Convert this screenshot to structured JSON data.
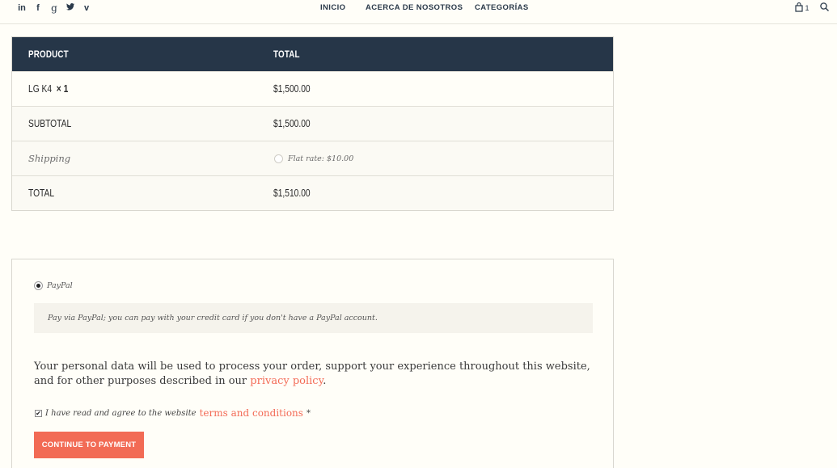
{
  "header": {
    "social": [
      "in",
      "f",
      "g",
      "t",
      "v"
    ],
    "social_icons": [
      "linkedin-icon",
      "facebook-icon",
      "google-plus-icon",
      "twitter-icon",
      "vimeo-icon"
    ],
    "nav": [
      "INICIO",
      "ACERCA DE NOSOTROS",
      "CATEGORÍAS"
    ],
    "cart_count": "1"
  },
  "order": {
    "head": {
      "product": "PRODUCT",
      "total": "TOTAL"
    },
    "item": {
      "name": "LG K4",
      "qty": "× 1",
      "total": "$1,500.00"
    },
    "subtotal": {
      "label": "SUBTOTAL",
      "value": "$1,500.00"
    },
    "shipping": {
      "label": "Shipping",
      "option": "Flat rate: $10.00"
    },
    "total": {
      "label": "TOTAL",
      "value": "$1,510.00"
    }
  },
  "payment": {
    "method": "PayPal",
    "description": "Pay via PayPal; you can pay with your credit card if you don't have a PayPal account.",
    "privacy_text": "Your personal data will be used to process your order, support your experience throughout this website, and for other purposes described in our ",
    "privacy_link": "privacy policy",
    "privacy_end": ".",
    "terms_text": "I have read and agree to the website ",
    "terms_link": "terms and conditions",
    "terms_required": "*",
    "button": "CONTINUE TO PAYMENT"
  },
  "colors": {
    "header_bg": "#263648",
    "accent": "#f26b55",
    "page_bg": "#fffef8"
  }
}
